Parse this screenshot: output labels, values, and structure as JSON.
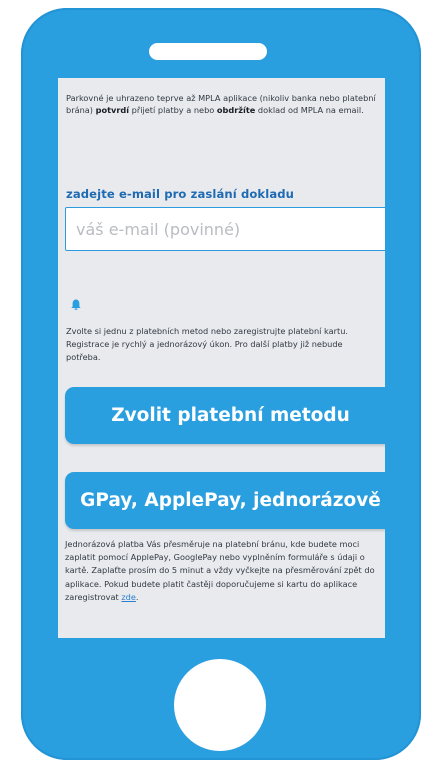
{
  "info": {
    "text_part1": "Parkovné je uhrazeno teprve až MPLA aplikace (nikoliv banka nebo platební brána) ",
    "bold1": "potvrdí",
    "text_part2": " přijetí platby a nebo ",
    "bold2": "obdržíte",
    "text_part3": " doklad od MPLA na email."
  },
  "email": {
    "label": "zadejte e-mail pro zaslání dokladu",
    "placeholder": "váš e-mail (povinné)",
    "value": ""
  },
  "notice_icon": "bell-icon",
  "methods_note": "Zvolte si jednu z platebních metod nebo zaregistrujte platební kartu. Registrace je rychlý a jednorázový úkon. Pro další platby již nebude potřeba.",
  "buttons": {
    "choose_method": "Zvolit platební metodu",
    "one_time": "GPay, ApplePay, jednorázově"
  },
  "onetime_note": {
    "text": "Jednorázová platba Vás přesměruje na platební bránu, kde budete moci zaplatit pomocí ApplePay, GooglePay nebo vyplněním formuláře s údaji o kartě. Zaplaťte prosím do 5 minut a vždy vyčkejte na přesměrování zpět do aplikace. Pokud budete platit častěji doporučujeme si kartu do aplikace zaregistrovat ",
    "link": "zde",
    "end": "."
  },
  "colors": {
    "phone": "#2a9fe0",
    "screen": "#e8eaed",
    "accent": "#2a9fe0",
    "label": "#1f6bb3"
  }
}
